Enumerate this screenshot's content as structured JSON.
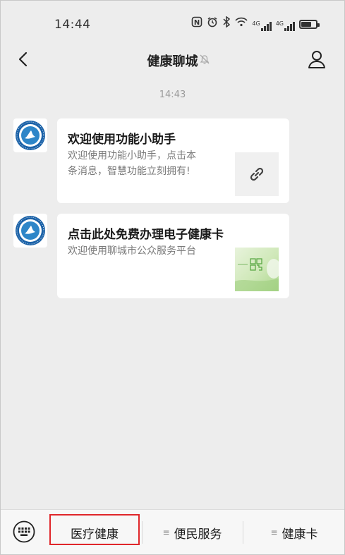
{
  "status_bar": {
    "time": "14:44",
    "indicators": [
      "nfc-icon",
      "alarm-icon",
      "bluetooth-icon",
      "wifi-icon",
      "signal-icon",
      "signal-icon",
      "battery-icon"
    ],
    "signal_labels": [
      "4G",
      "4G"
    ]
  },
  "nav": {
    "title": "健康聊城",
    "muted": true
  },
  "chat": {
    "timestamp": "14:43",
    "messages": [
      {
        "title": "欢迎使用功能小助手",
        "description_line1": "欢迎使用功能小助手，点击本",
        "description_line2": "条消息，智慧功能立刻拥有!",
        "thumbnail_icon": "link-icon"
      },
      {
        "title": "点击此处免费办理电子健康卡",
        "description": "欢迎使用聊城市公众服务平台",
        "thumbnail_icon": "health-card-thumbnail"
      }
    ]
  },
  "bottom_menu": {
    "items": [
      {
        "label": "医疗健康",
        "highlighted": true
      },
      {
        "label": "便民服务"
      },
      {
        "label": "健康卡"
      }
    ],
    "menu_glyph": "≡"
  },
  "colors": {
    "background": "#ededed",
    "card": "#ffffff",
    "highlight_border": "#e0262a",
    "thumb_green": "#cfe8b8"
  }
}
